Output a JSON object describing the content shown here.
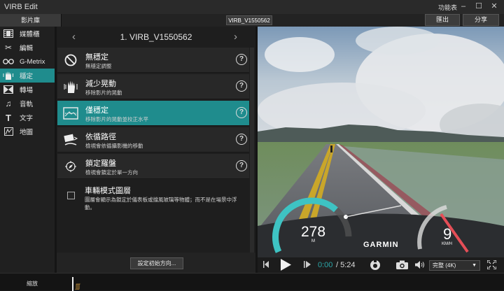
{
  "app": {
    "title": "VIRB Edit",
    "menu_label": "功能表",
    "window_controls": {
      "minimize": "–",
      "maximize": "☐",
      "close": "✕"
    }
  },
  "topbar": {
    "library_tab": "影片庫",
    "file_name": "VIRB_V1550562",
    "export_button": "匯出",
    "share_button": "分享"
  },
  "sidebar": {
    "items": [
      {
        "label": "媒體櫃",
        "icon": "film-icon",
        "active": false
      },
      {
        "label": "編輯",
        "icon": "scissors-icon",
        "active": false
      },
      {
        "label": "G-Metrix",
        "icon": "g-metrix-icon",
        "active": false
      },
      {
        "label": "穩定",
        "icon": "stabilize-hand-icon",
        "active": true
      },
      {
        "label": "轉場",
        "icon": "transition-icon",
        "active": false
      },
      {
        "label": "音軌",
        "icon": "music-note-icon",
        "active": false
      },
      {
        "label": "文字",
        "icon": "text-icon",
        "active": false
      },
      {
        "label": "地圖",
        "icon": "map-icon",
        "active": false
      }
    ]
  },
  "panel": {
    "clip_title": "1. VIRB_V1550562",
    "prev_arrow": "‹",
    "next_arrow": "›",
    "options": [
      {
        "title": "無穩定",
        "subtitle": "無穩定調整",
        "icon": "no-stabilization-icon",
        "active": false
      },
      {
        "title": "減少晃動",
        "subtitle": "移除影片的晃動",
        "icon": "reduce-shake-icon",
        "active": false
      },
      {
        "title": "僅穩定",
        "subtitle": "移除影片的晃動並校正水平",
        "icon": "stabilize-only-icon",
        "active": true
      },
      {
        "title": "依循路徑",
        "subtitle": "檢視會依循攝影機的移動",
        "icon": "follow-path-icon",
        "active": false
      },
      {
        "title": "鎖定羅盤",
        "subtitle": "檢視會鎖定於單一方向",
        "icon": "lock-compass-icon",
        "active": false
      }
    ],
    "help_symbol": "?",
    "vehicle_mode": {
      "title": "車輛模式圖層",
      "description": "圖層會顯示為鎖定於儀表板或擋風玻璃等物體；而不是在場景中浮動。",
      "checked": false
    },
    "set_direction_button": "設定初始方向..."
  },
  "video": {
    "altitude_value": "278",
    "altitude_unit": "M",
    "speed_value": "9",
    "speed_unit": "KM/H",
    "brand": "GARMIN"
  },
  "controls": {
    "time_current": "0:00",
    "time_total": "/ 5:24",
    "quality": "完整 (4K)"
  },
  "timeline": {
    "zoom_label": "縮放"
  }
}
